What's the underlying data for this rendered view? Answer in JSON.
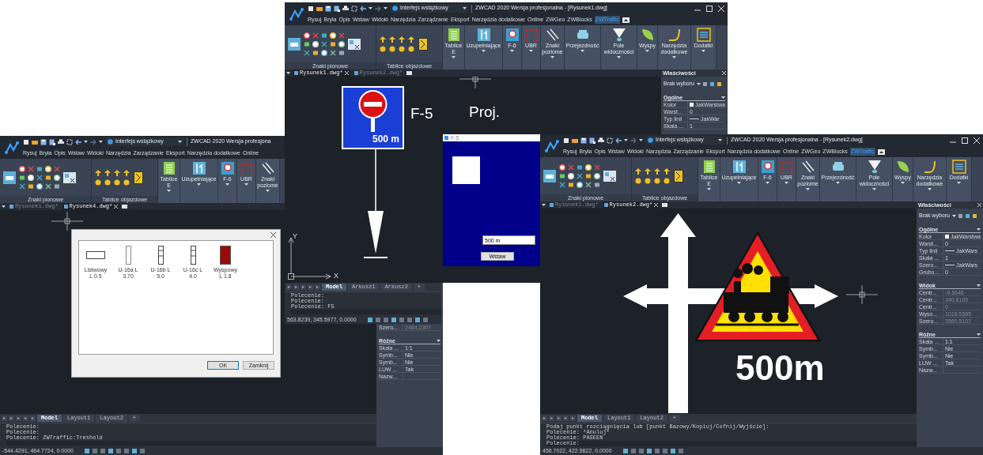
{
  "windows": [
    {
      "title": "ZWCAD 2020 Wersja profesjona",
      "workspace": "Interfejs wstążkowy",
      "menu": [
        {
          "label": "Rysuj",
          "selected": false
        },
        {
          "label": "Bryła",
          "selected": false
        },
        {
          "label": "Opis",
          "selected": false
        },
        {
          "label": "Wstaw",
          "selected": false
        },
        {
          "label": "Widoki",
          "selected": false
        },
        {
          "label": "Narzędzia",
          "selected": false
        },
        {
          "label": "Zarządzanie",
          "selected": false
        },
        {
          "label": "Eksport",
          "selected": false
        },
        {
          "label": "Narzędzia dodatkowe",
          "selected": false
        },
        {
          "label": "Online",
          "selected": false
        }
      ],
      "ribbon": {
        "groups": [
          "Znaki pionowe",
          "Tablice objazdowe"
        ],
        "buttons": [
          {
            "lines": [
              "Tablice",
              "E"
            ]
          },
          {
            "lines": [
              "Uzupełniające"
            ]
          },
          {
            "lines": [
              "F-6"
            ]
          },
          {
            "lines": [
              "UBR"
            ]
          },
          {
            "lines": [
              "Znaki",
              "poziome"
            ]
          }
        ]
      },
      "doc_tabs": [
        {
          "label": "Rysunek1.dwg*",
          "selected": false
        },
        {
          "label": "Rysunek4.dwg*",
          "selected": true
        }
      ],
      "canvas": {
        "kind": "list_dialog",
        "items": [
          {
            "kind": "wide",
            "lines": [
              "Listwowy",
              "L 0.5"
            ]
          },
          {
            "kind": "tall",
            "lines": [
              "U-16a L",
              "3.70"
            ]
          },
          {
            "kind": "split",
            "lines": [
              "U-16b L",
              "5.0"
            ]
          },
          {
            "kind": "split",
            "lines": [
              "U-16c L",
              "4.0"
            ]
          },
          {
            "kind": "filled",
            "lines": [
              "Wyspowy",
              "L 1.8"
            ]
          }
        ],
        "buttons": [
          {
            "label": "OK",
            "selected": true
          },
          {
            "label": "Zamknij",
            "selected": false
          }
        ]
      },
      "layout_tabs": [
        {
          "label": "Model",
          "selected": true
        },
        {
          "label": "Layout1",
          "selected": false
        },
        {
          "label": "Layout2",
          "selected": false
        },
        {
          "label": "+",
          "selected": false
        }
      ],
      "command_lines": [
        "Polecenie:",
        "Polecenie:",
        "Polecenie: ZWTraffic:Treshold"
      ],
      "coordinates": "-544.4291, 464.7724, 0.0000",
      "properties": {
        "sections": [
          {
            "disabled": true,
            "rows": [
              {
                "label": "Szero...",
                "value": "2484.2307",
                "kind": "plain"
              }
            ]
          },
          {
            "title": "Różne",
            "disabled": false,
            "rows": [
              {
                "label": "Skala ...",
                "value": "1:1",
                "kind": "plain"
              },
              {
                "label": "Symb...",
                "value": "Nie",
                "kind": "plain"
              },
              {
                "label": "Symb...",
                "value": "Nie",
                "kind": "plain"
              },
              {
                "label": "LUW ...",
                "value": "Tak",
                "kind": "plain"
              },
              {
                "label": "Nazw...",
                "kind": "plain"
              }
            ]
          }
        ]
      }
    },
    {
      "title": "ZWCAD 2020 Wersja profesjonalna - [Rysunek1.dwg]",
      "workspace": "Interfejs wstążkowy",
      "menu": [
        {
          "label": "Rysuj",
          "selected": false
        },
        {
          "label": "Bryła",
          "selected": false
        },
        {
          "label": "Opis",
          "selected": false
        },
        {
          "label": "Wstaw",
          "selected": false
        },
        {
          "label": "Widoki",
          "selected": false
        },
        {
          "label": "Narzędzia",
          "selected": false
        },
        {
          "label": "Zarządzanie",
          "selected": false
        },
        {
          "label": "Eksport",
          "selected": false
        },
        {
          "label": "Narzędzia dodatkowe",
          "selected": false
        },
        {
          "label": "Online",
          "selected": false
        },
        {
          "label": "ZWGeo",
          "selected": false
        },
        {
          "label": "ZWBlocks",
          "selected": false
        },
        {
          "label": "ZWTraffic",
          "selected": true
        }
      ],
      "ribbon": {
        "groups": [
          "Znaki pionowe",
          "Tablice objazdowe"
        ],
        "buttons": [
          {
            "lines": [
              "Tablice",
              "E"
            ]
          },
          {
            "lines": [
              "Uzupełniające"
            ]
          },
          {
            "lines": [
              "F-6"
            ]
          },
          {
            "lines": [
              "UBR"
            ]
          },
          {
            "lines": [
              "Znaki",
              "poziome"
            ]
          },
          {
            "lines": [
              "Przejezdność"
            ]
          },
          {
            "lines": [
              "Pole",
              "widoczności"
            ]
          },
          {
            "lines": [
              "Wyspy"
            ]
          },
          {
            "lines": [
              "Narzędzia",
              "dodatkowe"
            ]
          },
          {
            "lines": [
              "Dodatki"
            ]
          }
        ]
      },
      "doc_tabs": [
        {
          "label": "Rysunek1.dwg*",
          "selected": true
        },
        {
          "label": "Rysunek2.dwg*",
          "selected": false
        }
      ],
      "canvas": {
        "kind": "sign_drawing",
        "sign_text": "500 m",
        "labels": [
          "F-5",
          "Proj."
        ],
        "axes": [
          "Y",
          "X"
        ],
        "dialog": {
          "title": "F-5",
          "value": "500 m",
          "button": "Wstaw"
        }
      },
      "layout_tabs": [
        {
          "label": "Model",
          "selected": true
        },
        {
          "label": "Arkusz1",
          "selected": false
        },
        {
          "label": "Arkusz2",
          "selected": false
        },
        {
          "label": "+",
          "selected": false
        }
      ],
      "command_lines": [
        "Polecenie:",
        "Polecenie:",
        "Polecenie: F5"
      ],
      "coordinates": "563.8239, 345.5977, 0.0000",
      "properties": {
        "title": "Właściwości",
        "selection": "Brak wyboru",
        "sections": [
          {
            "title": "Ogólne",
            "disabled": false,
            "rows": [
              {
                "label": "Kolor",
                "value": "JakWarstwa",
                "kind": "swatch"
              },
              {
                "label": "Warst...",
                "value": "0",
                "kind": "plain"
              },
              {
                "label": "Typ linii",
                "value": "JakWar",
                "kind": "line"
              },
              {
                "label": "Skala ...",
                "value": "1",
                "kind": "plain"
              }
            ]
          }
        ]
      }
    },
    {
      "title": "ZWCAD 2020 Wersja profesjonalna - [Rysunek2.dwg]",
      "workspace": "Interfejs wstążkowy",
      "menu": [
        {
          "label": "Rysuj",
          "selected": false
        },
        {
          "label": "Bryła",
          "selected": false
        },
        {
          "label": "Opis",
          "selected": false
        },
        {
          "label": "Wstaw",
          "selected": false
        },
        {
          "label": "Widoki",
          "selected": false
        },
        {
          "label": "Narzędzia",
          "selected": false
        },
        {
          "label": "Zarządzanie",
          "selected": false
        },
        {
          "label": "Eksport",
          "selected": false
        },
        {
          "label": "Narzędzia dodatkowe",
          "selected": false
        },
        {
          "label": "Online",
          "selected": false
        },
        {
          "label": "ZWGeo",
          "selected": false
        },
        {
          "label": "ZWBlocks",
          "selected": false
        },
        {
          "label": "ZWTraffic",
          "selected": true
        }
      ],
      "ribbon": {
        "groups": [
          "Znaki pionowe",
          "Tablice objazdowe"
        ],
        "buttons": [
          {
            "lines": [
              "Tablice",
              "E"
            ]
          },
          {
            "lines": [
              "Uzupełniające"
            ]
          },
          {
            "lines": [
              "F-6"
            ]
          },
          {
            "lines": [
              "UBR"
            ]
          },
          {
            "lines": [
              "Znaki",
              "poziome"
            ]
          },
          {
            "lines": [
              "Przejezdność"
            ]
          },
          {
            "lines": [
              "Pole",
              "widoczności"
            ]
          },
          {
            "lines": [
              "Wyspy"
            ]
          },
          {
            "lines": [
              "Narzędzia",
              "dodatkowe"
            ]
          },
          {
            "lines": [
              "Dodatki"
            ]
          }
        ]
      },
      "doc_tabs": [
        {
          "label": "Rysunek1.dwg*",
          "selected": false
        },
        {
          "label": "Rysunek2.dwg*",
          "selected": true
        }
      ],
      "canvas": {
        "kind": "crossing_drawing",
        "text": "500m"
      },
      "layout_tabs": [
        {
          "label": "Model",
          "selected": true
        },
        {
          "label": "Layout1",
          "selected": false
        },
        {
          "label": "Layout2",
          "selected": false
        },
        {
          "label": "+",
          "selected": false
        }
      ],
      "command_lines": [
        "Podaj punkt rozciągnięcia lub [punkt Bazowy/Kopiuj/Cofnij/Wyjście]:",
        "Polecenie: *Anuluj*",
        "Polecenie: PASEEN"
      ],
      "command_prompt": "Polecenie:",
      "coordinates": "456.7022, 422.5822, 0.0000",
      "properties": {
        "title": "Właściwości",
        "selection": "Brak wyboru",
        "sections": [
          {
            "title": "Ogólne",
            "disabled": false,
            "rows": [
              {
                "label": "Kolor",
                "value": "JakWarstwa",
                "kind": "swatch"
              },
              {
                "label": "Warst...",
                "value": "0",
                "kind": "plain"
              },
              {
                "label": "Typ linii",
                "value": "JakWars",
                "kind": "line"
              },
              {
                "label": "Skala ...",
                "value": "1",
                "kind": "plain"
              },
              {
                "label": "Szero...",
                "value": "JakWars",
                "kind": "line"
              },
              {
                "label": "Grubo...",
                "value": "0",
                "kind": "plain"
              }
            ]
          },
          {
            "title": "Widok",
            "disabled": true,
            "rows": [
              {
                "label": "Centr...",
                "value": "-9.6646",
                "kind": "plain"
              },
              {
                "label": "Centr...",
                "value": "340.8106",
                "kind": "plain"
              },
              {
                "label": "Centr...",
                "value": "0",
                "kind": "plain"
              },
              {
                "label": "Wyso...",
                "value": "1018.5585",
                "kind": "plain"
              },
              {
                "label": "Szero...",
                "value": "3560.5107",
                "kind": "plain"
              }
            ]
          },
          {
            "title": "Różne",
            "disabled": false,
            "rows": [
              {
                "label": "Skala ...",
                "value": "1:1",
                "kind": "plain"
              },
              {
                "label": "Symb...",
                "value": "Nie",
                "kind": "plain"
              },
              {
                "label": "Symb...",
                "value": "Nie",
                "kind": "plain"
              },
              {
                "label": "LUW ...",
                "value": "Tak",
                "kind": "plain"
              },
              {
                "label": "Nazw...",
                "kind": "plain"
              }
            ]
          }
        ]
      }
    }
  ]
}
